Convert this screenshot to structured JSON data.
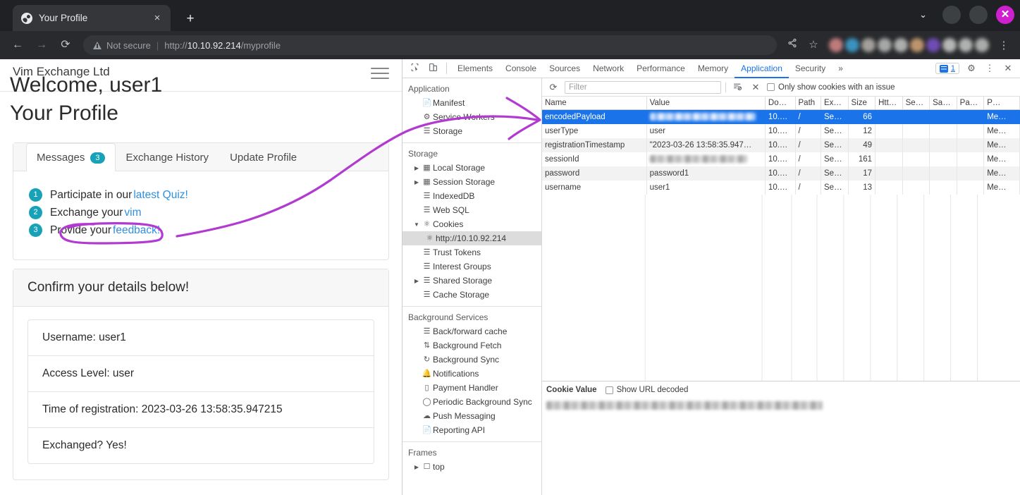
{
  "browser": {
    "tab": {
      "title": "Your Profile",
      "favicon": "globe-icon",
      "close": "×"
    },
    "newtab_label": "+",
    "window": {
      "chevron": "⌄",
      "close_label": "✕"
    },
    "nav": {
      "back": "←",
      "forward": "→",
      "reload": "⟳",
      "security_label": "Not secure",
      "url_scheme": "http://",
      "url_host": "10.10.92.214",
      "url_path": "/myprofile",
      "share": "share-icon",
      "bookmark": "☆",
      "menu": "⋮"
    }
  },
  "page": {
    "brand": "Vim Exchange Ltd",
    "welcome": "Welcome, user1",
    "heading": "Your Profile",
    "tabs": [
      {
        "label": "Messages",
        "badge": "3",
        "active": true
      },
      {
        "label": "Exchange History",
        "badge": "",
        "active": false
      },
      {
        "label": "Update Profile",
        "badge": "",
        "active": false
      }
    ],
    "messages": [
      {
        "n": "1",
        "text": "Participate in our ",
        "link": "latest Quiz!"
      },
      {
        "n": "2",
        "text": "Exchange your ",
        "link": "vim"
      },
      {
        "n": "3",
        "text": "Provide your ",
        "link": "feedback!"
      }
    ],
    "details_title": "Confirm your details below!",
    "details": [
      "Username:  user1",
      "Access Level:  user",
      "Time of registration: 2023-03-26 13:58:35.947215",
      "Exchanged? Yes!"
    ]
  },
  "devtools": {
    "toolbar": {
      "inspect_icon": "inspect-element-icon",
      "device_icon": "device-toolbar-icon",
      "tabs": [
        "Elements",
        "Console",
        "Sources",
        "Network",
        "Performance",
        "Memory",
        "Application",
        "Security"
      ],
      "active_tab": "Application",
      "overflow": "»",
      "issues_count": "1",
      "settings_icon": "⚙",
      "more_icon": "⋮",
      "close_icon": "✕"
    },
    "sidebar": {
      "sections": [
        {
          "title": "Application",
          "items": [
            {
              "label": "Manifest",
              "icon": "manifest-icon",
              "twisty": ""
            },
            {
              "label": "Service Workers",
              "icon": "gear-icon",
              "twisty": ""
            },
            {
              "label": "Storage",
              "icon": "database-icon",
              "twisty": ""
            }
          ]
        },
        {
          "title": "Storage",
          "items": [
            {
              "label": "Local Storage",
              "icon": "table-icon",
              "twisty": "▶"
            },
            {
              "label": "Session Storage",
              "icon": "table-icon",
              "twisty": "▶"
            },
            {
              "label": "IndexedDB",
              "icon": "database-icon",
              "twisty": ""
            },
            {
              "label": "Web SQL",
              "icon": "database-icon",
              "twisty": ""
            },
            {
              "label": "Cookies",
              "icon": "cookie-icon",
              "twisty": "▼"
            },
            {
              "label": "http://10.10.92.214",
              "icon": "cookie-icon",
              "twisty": "",
              "indent": true,
              "selected": true
            },
            {
              "label": "Trust Tokens",
              "icon": "database-icon",
              "twisty": ""
            },
            {
              "label": "Interest Groups",
              "icon": "database-icon",
              "twisty": ""
            },
            {
              "label": "Shared Storage",
              "icon": "database-icon",
              "twisty": "▶"
            },
            {
              "label": "Cache Storage",
              "icon": "database-icon",
              "twisty": ""
            }
          ]
        },
        {
          "title": "Background Services",
          "items": [
            {
              "label": "Back/forward cache",
              "icon": "database-icon",
              "twisty": ""
            },
            {
              "label": "Background Fetch",
              "icon": "updown-arrows-icon",
              "twisty": ""
            },
            {
              "label": "Background Sync",
              "icon": "sync-icon",
              "twisty": ""
            },
            {
              "label": "Notifications",
              "icon": "bell-icon",
              "twisty": ""
            },
            {
              "label": "Payment Handler",
              "icon": "card-icon",
              "twisty": ""
            },
            {
              "label": "Periodic Background Sync",
              "icon": "clock-icon",
              "twisty": ""
            },
            {
              "label": "Push Messaging",
              "icon": "cloud-icon",
              "twisty": ""
            },
            {
              "label": "Reporting API",
              "icon": "document-icon",
              "twisty": ""
            }
          ]
        },
        {
          "title": "Frames",
          "items": [
            {
              "label": "top",
              "icon": "frame-icon",
              "twisty": "▶"
            }
          ]
        }
      ]
    },
    "filterbar": {
      "refresh_icon": "⟳",
      "placeholder": "Filter",
      "clear_filters_icon": "clear-filter-icon",
      "delete_icon": "✕",
      "checkbox_label": "Only show cookies with an issue",
      "checkbox_checked": false
    },
    "table": {
      "columns": [
        "Name",
        "Value",
        "Do…",
        "Path",
        "Ex…",
        "Size",
        "Htt…",
        "Se…",
        "Sa…",
        "Pa…",
        "P…"
      ],
      "rows": [
        {
          "name": "encodedPayload",
          "value": "",
          "value_redacted": true,
          "domain": "10.…",
          "path": "/",
          "expires": "Se…",
          "size": "66",
          "httponly": "",
          "secure": "",
          "samesite": "",
          "partition": "",
          "priority": "Me…",
          "selected": true
        },
        {
          "name": "userType",
          "value": "user",
          "value_redacted": false,
          "domain": "10.…",
          "path": "/",
          "expires": "Se…",
          "size": "12",
          "httponly": "",
          "secure": "",
          "samesite": "",
          "partition": "",
          "priority": "Me…",
          "selected": false
        },
        {
          "name": "registrationTimestamp",
          "value": "\"2023-03-26 13:58:35.947…",
          "value_redacted": false,
          "domain": "10.…",
          "path": "/",
          "expires": "Se…",
          "size": "49",
          "httponly": "",
          "secure": "",
          "samesite": "",
          "partition": "",
          "priority": "Me…",
          "selected": false
        },
        {
          "name": "sessionId",
          "value": "",
          "value_redacted": true,
          "domain": "10.…",
          "path": "/",
          "expires": "Se…",
          "size": "161",
          "httponly": "",
          "secure": "",
          "samesite": "",
          "partition": "",
          "priority": "Me…",
          "selected": false
        },
        {
          "name": "password",
          "value": "password1",
          "value_redacted": false,
          "domain": "10.…",
          "path": "/",
          "expires": "Se…",
          "size": "17",
          "httponly": "",
          "secure": "",
          "samesite": "",
          "partition": "",
          "priority": "Me…",
          "selected": false
        },
        {
          "name": "username",
          "value": "user1",
          "value_redacted": false,
          "domain": "10.…",
          "path": "/",
          "expires": "Se…",
          "size": "13",
          "httponly": "",
          "secure": "",
          "samesite": "",
          "partition": "",
          "priority": "Me…",
          "selected": false
        }
      ]
    },
    "value_pane": {
      "title": "Cookie Value",
      "checkbox_label": "Show URL decoded",
      "checkbox_checked": false,
      "value_redacted": true
    }
  },
  "annotation": {
    "color": "#b23ad1",
    "shapes": [
      "circle-around-exchange-your-vim",
      "arrow-to-encodedpayload-row"
    ]
  }
}
